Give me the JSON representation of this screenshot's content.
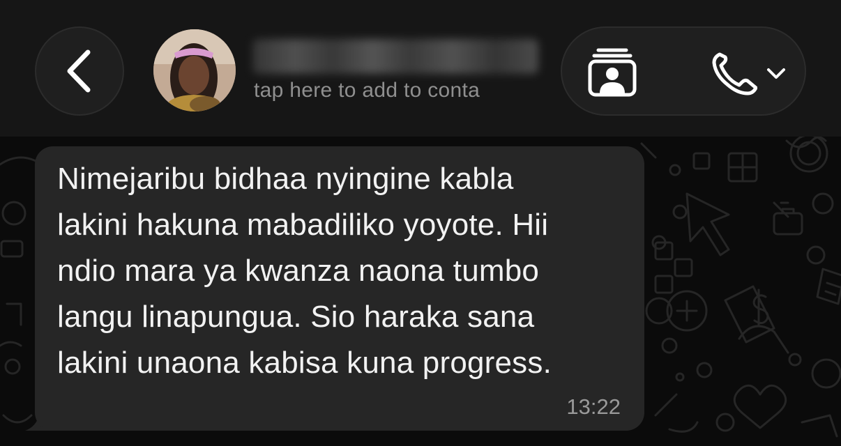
{
  "header": {
    "subtitle": "tap here to add to conta",
    "back_icon": "chevron-left-icon",
    "contact_card_icon": "contact-card-icon",
    "call_icon": "phone-icon",
    "call_menu_icon": "chevron-down-icon"
  },
  "message": {
    "lines": [
      "Nimejaribu bidhaa nyingine kabla",
      "lakini hakuna mabadiliko yoyote. Hii",
      "ndio mara ya kwanza naona tumbo",
      "langu linapungua. Sio haraka sana",
      "lakini unaona kabisa kuna progress."
    ],
    "time": "13:22"
  },
  "colors": {
    "background": "#0b0b0b",
    "header": "#161616",
    "bubble": "#262626",
    "text": "#f2f2f2",
    "muted": "#8f8f8f"
  }
}
